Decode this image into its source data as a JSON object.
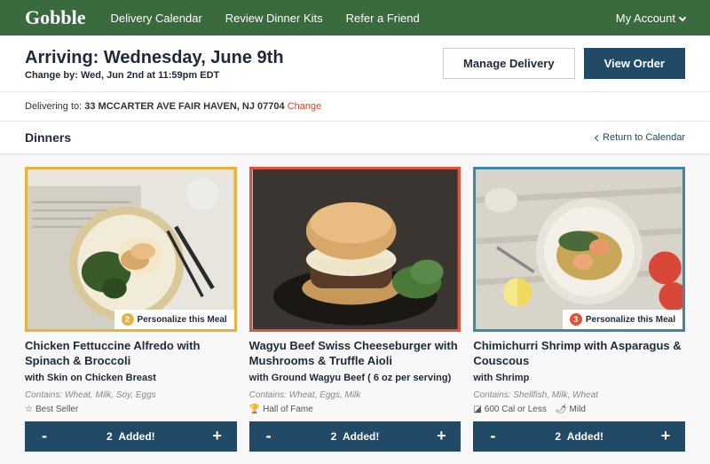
{
  "header": {
    "logo": "Gobble",
    "nav": [
      "Delivery Calendar",
      "Review Dinner Kits",
      "Refer a Friend"
    ],
    "account": "My Account"
  },
  "delivery": {
    "title": "Arriving: Wednesday, June 9th",
    "change_by": "Change by: Wed, Jun 2nd at 11:59pm EDT",
    "manage_btn": "Manage Delivery",
    "view_btn": "View Order"
  },
  "address": {
    "prefix": "Delivering to: ",
    "value": "33 MCCARTER AVE FAIR HAVEN, NJ 07704",
    "change": "Change"
  },
  "section": {
    "title": "Dinners",
    "return": "Return to Calendar"
  },
  "meals": [
    {
      "personalize_count": "2",
      "personalize_label": "Personalize this Meal",
      "title": "Chicken Fettuccine Alfredo with Spinach & Broccoli",
      "sub": "with Skin on Chicken Breast",
      "contains": "Contains: Wheat, Milk, Soy, Eggs",
      "tags": [
        {
          "icon": "ribbon",
          "label": "Best Seller"
        }
      ],
      "qty": "2",
      "added": "Added!"
    },
    {
      "title": "Wagyu Beef Swiss Cheeseburger with Mushrooms & Truffle Aioli",
      "sub": "with Ground Wagyu Beef ( 6 oz per serving)",
      "contains": "Contains: Wheat, Eggs, Milk",
      "tags": [
        {
          "icon": "trophy",
          "label": "Hall of Fame"
        }
      ],
      "qty": "2",
      "added": "Added!"
    },
    {
      "personalize_count": "3",
      "personalize_label": "Personalize this Meal",
      "title": "Chimichurri Shrimp with Asparagus & Couscous",
      "sub": "with Shrimp",
      "contains": "Contains: Shellfish, Milk, Wheat",
      "tags": [
        {
          "icon": "cal",
          "label": "600 Cal or Less"
        },
        {
          "icon": "pepper",
          "label": "Mild"
        }
      ],
      "qty": "2",
      "added": "Added!"
    }
  ]
}
